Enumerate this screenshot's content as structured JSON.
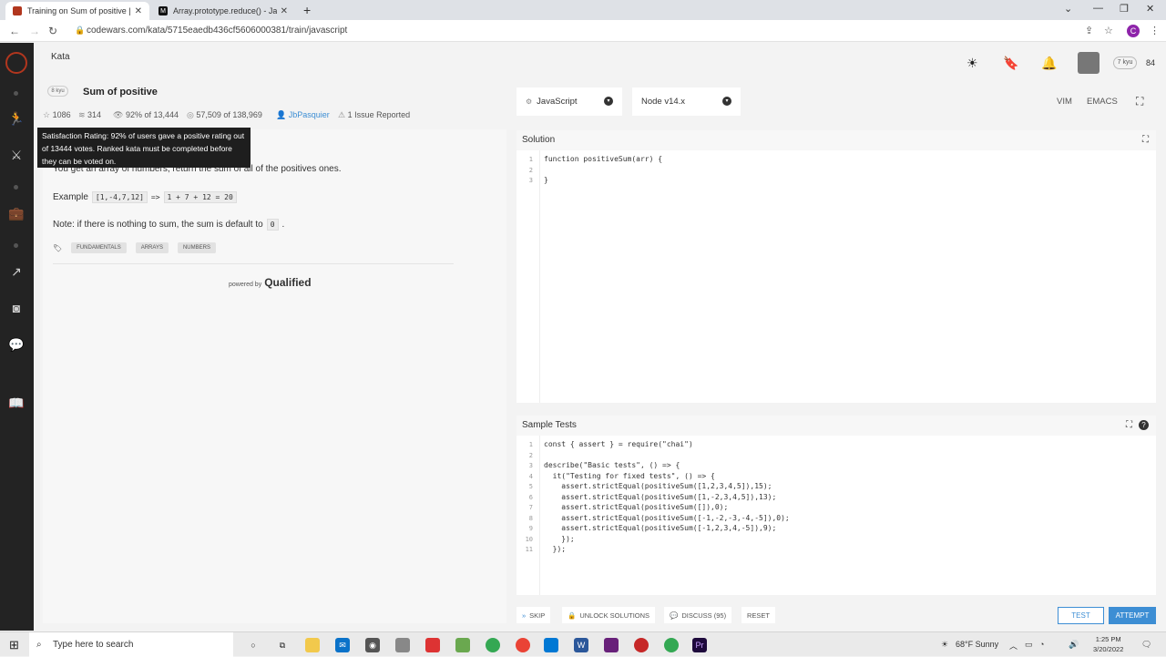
{
  "browser": {
    "tabs": [
      {
        "title": "Training on Sum of positive | Co"
      },
      {
        "title": "Array.prototype.reduce() - JavaSc"
      }
    ],
    "url": "codewars.com/kata/5715eaedb436cf5606000381/train/javascript",
    "profile_initial": "C"
  },
  "header": {
    "kata_tab": "Kata",
    "rank_badge": "7 kyu",
    "honor": "84"
  },
  "kata": {
    "kyu": "8 kyu",
    "title": "Sum of positive",
    "stars": "1086",
    "collections": "314",
    "satisfaction": "92% of 13,444",
    "completed": "57,509 of 138,969",
    "author": "JbPasquier",
    "issues": "1 Issue Reported",
    "tooltip": "Satisfaction Rating: 92% of users gave a positive rating out of 13444 votes. Ranked kata must be completed before they can be voted on.",
    "description": "You get an array of numbers, return the sum of all of the positives ones.",
    "example_label": "Example",
    "example_input": "[1,-4,7,12]",
    "example_arrow": "=>",
    "example_output": "1 + 7 + 12 = 20",
    "note": "Note: if there is nothing to sum, the sum is default to",
    "note_code": "0",
    "note_end": ".",
    "tags": [
      "FUNDAMENTALS",
      "ARRAYS",
      "NUMBERS"
    ],
    "powered_by": "powered by",
    "powered_brand": "Qualified"
  },
  "editor": {
    "language": "JavaScript",
    "runtime": "Node v14.x",
    "modes": [
      "VIM",
      "EMACS"
    ],
    "solution_title": "Solution",
    "solution_lines": [
      "function positiveSum(arr) {",
      "",
      "}"
    ],
    "tests_title": "Sample Tests",
    "test_lines": [
      "const { assert } = require(\"chai\")",
      "",
      "describe(\"Basic tests\", () => {",
      "  it(\"Testing for fixed tests\", () => {",
      "    assert.strictEqual(positiveSum([1,2,3,4,5]),15);",
      "    assert.strictEqual(positiveSum([1,-2,3,4,5]),13);",
      "    assert.strictEqual(positiveSum([]),0);",
      "    assert.strictEqual(positiveSum([-1,-2,-3,-4,-5]),0);",
      "    assert.strictEqual(positiveSum([-1,2,3,4,-5]),9);",
      "    });",
      "  });"
    ]
  },
  "actions": {
    "skip": "SKIP",
    "unlock": "UNLOCK SOLUTIONS",
    "discuss": "DISCUSS (95)",
    "reset": "RESET",
    "test": "TEST",
    "attempt": "ATTEMPT"
  },
  "taskbar": {
    "search_placeholder": "Type here to search",
    "weather": "68°F  Sunny",
    "time": "1:25 PM",
    "date": "3/20/2022"
  },
  "colors": {
    "sidebar": "#232323",
    "accent": "#3d8ed4",
    "brand": "#b1361e"
  }
}
